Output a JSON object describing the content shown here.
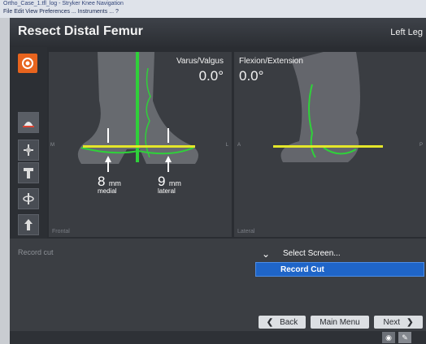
{
  "window": {
    "title_bar_text": "Ortho_Case_1.tfl_log - Stryker Knee Navigation",
    "menu_text": "File  Edit  View Preferences ...  Instruments ...  ?"
  },
  "app": {
    "title": "Resect Distal Femur",
    "side": "Left Leg"
  },
  "frontal_view": {
    "label": "Varus/Valgus",
    "value": "0.0°",
    "corner": "Frontal",
    "left_axis": "M",
    "right_axis": "L",
    "medial_value": "8",
    "medial_unit": "mm",
    "medial_label": "medial",
    "lateral_value": "9",
    "lateral_unit": "mm",
    "lateral_label": "lateral"
  },
  "lateral_view": {
    "label": "Flexion/Extension",
    "value": "0.0°",
    "corner": "Lateral",
    "left_axis": "A",
    "right_axis": "P"
  },
  "bottom": {
    "record_label": "Record cut",
    "select_screen": "Select Screen...",
    "record_cut": "Record Cut"
  },
  "nav": {
    "back": "Back",
    "main_menu": "Main Menu",
    "next": "Next"
  },
  "colors": {
    "accent": "#1f65c8",
    "bone_line": "#2fd13a",
    "cut_plane": "#e4e62a"
  },
  "icons": [
    "logo-icon",
    "distal-femur-icon",
    "frontal-alignment-icon",
    "tibia-icon",
    "rotation-icon",
    "ap-cut-icon",
    "camera-icon",
    "pen-icon"
  ]
}
